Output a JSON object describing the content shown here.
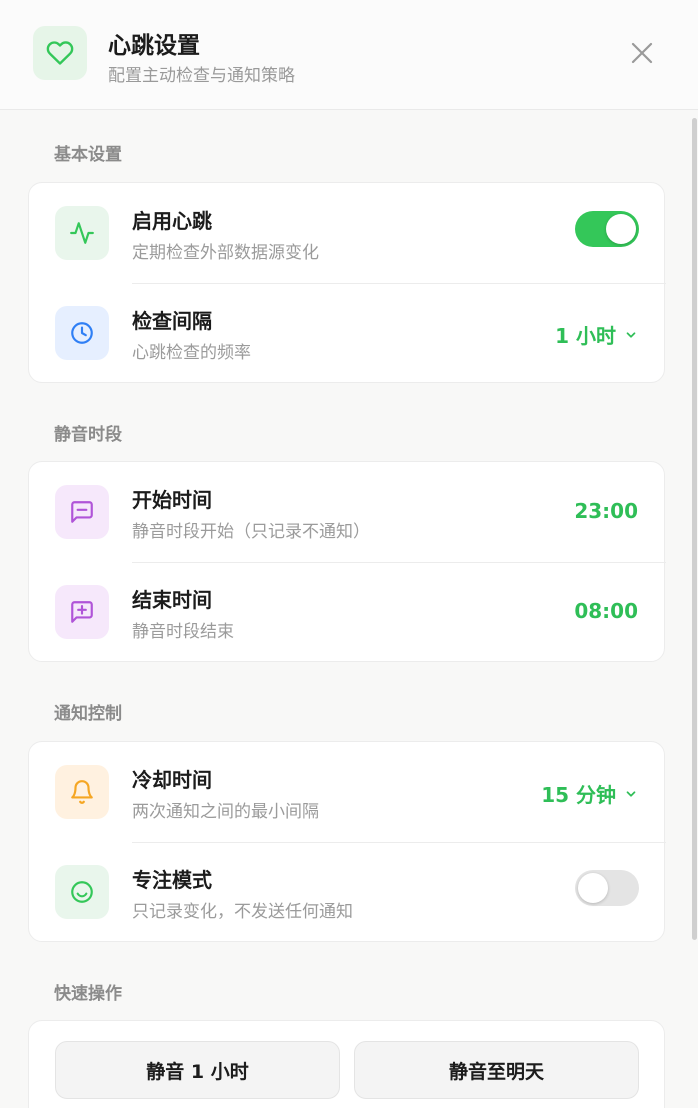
{
  "header": {
    "title": "心跳设置",
    "subtitle": "配置主动检查与通知策略",
    "icon": "heart-icon"
  },
  "sections": {
    "basic": {
      "label": "基本设置",
      "enable": {
        "title": "启用心跳",
        "subtitle": "定期检查外部数据源变化",
        "enabled": true,
        "icon": "activity-icon"
      },
      "interval": {
        "title": "检查间隔",
        "subtitle": "心跳检查的频率",
        "value": "1 小时",
        "icon": "clock-icon"
      }
    },
    "quiet": {
      "label": "静音时段",
      "start": {
        "title": "开始时间",
        "subtitle": "静音时段开始（只记录不通知）",
        "value": "23:00",
        "icon": "message-minus-icon"
      },
      "end": {
        "title": "结束时间",
        "subtitle": "静音时段结束",
        "value": "08:00",
        "icon": "message-plus-icon"
      }
    },
    "notify": {
      "label": "通知控制",
      "cooldown": {
        "title": "冷却时间",
        "subtitle": "两次通知之间的最小间隔",
        "value": "15 分钟",
        "icon": "bell-icon"
      },
      "focus": {
        "title": "专注模式",
        "subtitle": "只记录变化，不发送任何通知",
        "enabled": false,
        "icon": "smile-icon"
      }
    },
    "quick": {
      "label": "快速操作",
      "mute_hour": "静音 1 小时",
      "mute_tomorrow": "静音至明天"
    }
  },
  "colors": {
    "accent": "#34c759",
    "accent_text": "#2fbe57",
    "blue": "#2f7ff5",
    "purple": "#b054d8",
    "orange": "#f5a623"
  }
}
